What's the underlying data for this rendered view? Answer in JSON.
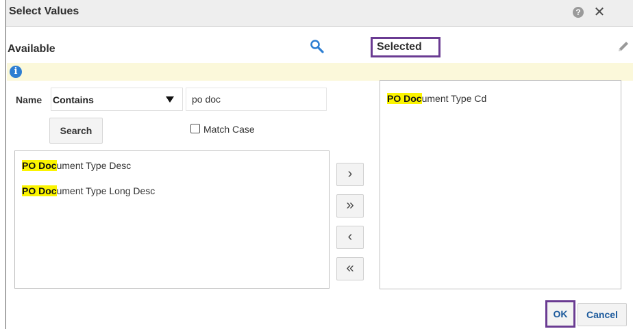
{
  "window": {
    "title": "Select Values"
  },
  "icons": {
    "help": "help-icon",
    "close": "close-icon",
    "search": "search-icon",
    "edit": "pencil-icon",
    "info": "info-icon"
  },
  "glyphs": {
    "help": "?",
    "close": "✕",
    "info": "i"
  },
  "available": {
    "heading": "Available"
  },
  "selected": {
    "heading": "Selected"
  },
  "filter": {
    "name_label": "Name",
    "operator": "Contains",
    "query": "po doc",
    "search_label": "Search",
    "match_case_label": "Match Case",
    "match_case_checked": false
  },
  "available_items": [
    {
      "highlight": "PO Doc",
      "rest": "ument Type Desc"
    },
    {
      "highlight": "PO Doc",
      "rest": "ument Type Long Desc"
    }
  ],
  "selected_items": [
    {
      "highlight": "PO Doc",
      "rest": "ument Type Cd"
    }
  ],
  "move_buttons": {
    "move": "›",
    "move_all": "»",
    "remove": "‹",
    "remove_all": "«"
  },
  "footer": {
    "ok_label": "OK",
    "cancel_label": "Cancel"
  },
  "colors": {
    "accent_outline": "#6a3b92",
    "highlight": "#fbf400",
    "link_text": "#1c5a9c",
    "info_bar": "#fbf8da",
    "info_icon": "#2d7ed2"
  }
}
